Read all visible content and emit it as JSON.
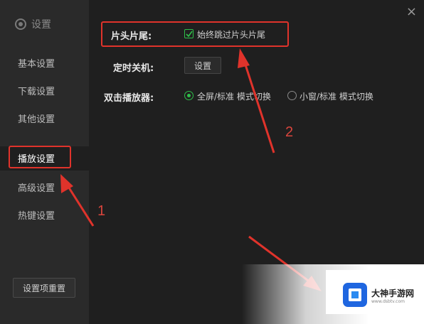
{
  "window": {
    "title": "设置",
    "close_glyph": "×"
  },
  "sidebar": {
    "items": [
      {
        "label": "基本设置"
      },
      {
        "label": "下载设置"
      },
      {
        "label": "其他设置"
      },
      {
        "label": "播放设置"
      },
      {
        "label": "高级设置"
      },
      {
        "label": "热键设置"
      }
    ],
    "active_index": 3,
    "reset_label": "设置项重置"
  },
  "main": {
    "intro_outro": {
      "label": "片头片尾:",
      "checkbox_label": "始终跳过片头片尾",
      "checked": true
    },
    "timer_shutdown": {
      "label": "定时关机:",
      "button_label": "设置"
    },
    "double_click": {
      "label": "双击播放器:",
      "options": [
        {
          "label": "全屏/标准 模式切换",
          "selected": true
        },
        {
          "label": "小窗/标准 模式切换",
          "selected": false
        }
      ]
    }
  },
  "annotations": {
    "marker_1": "1",
    "marker_2": "2",
    "color": "#e0332b"
  },
  "watermark": {
    "name": "大神手游网",
    "url": "www.dsbtv.com"
  },
  "colors": {
    "accent_green": "#2fbf4a",
    "highlight_red": "#e0332b",
    "sidebar_bg": "#2a2a2a",
    "main_bg": "#1f1f1f"
  }
}
